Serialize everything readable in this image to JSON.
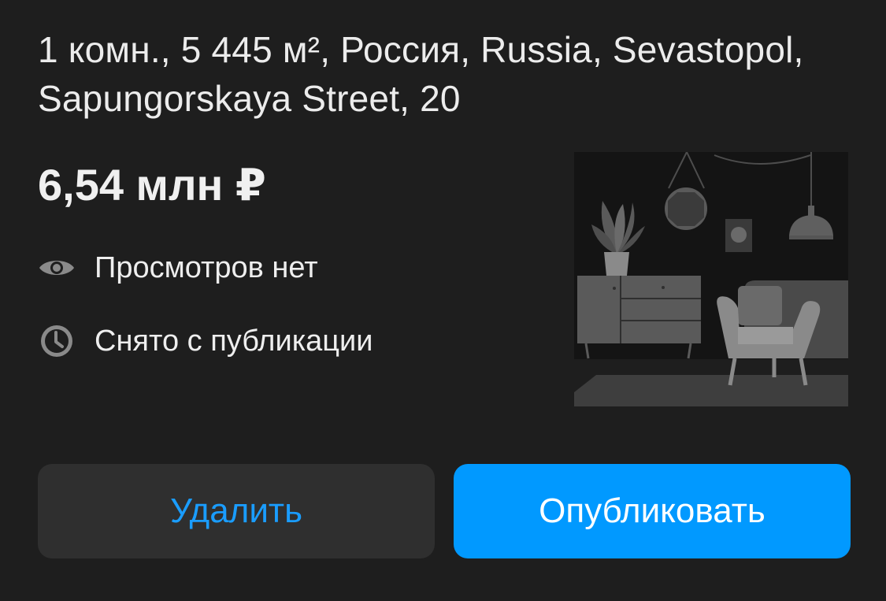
{
  "listing": {
    "title": "1 комн., 5 445 м², Россия, Russia, Sevastopol, Sapungorskaya Street, 20",
    "price": "6,54 млн ₽",
    "views_text": "Просмотров нет",
    "status_text": "Снято с публикации"
  },
  "icons": {
    "views": "eye-icon",
    "status": "clock-icon"
  },
  "actions": {
    "delete_label": "Удалить",
    "publish_label": "Опубликовать"
  },
  "colors": {
    "background": "#1e1e1e",
    "accent": "#0199ff",
    "secondary_button": "#2f2f2f",
    "icon_gray": "#8a8a8a"
  }
}
